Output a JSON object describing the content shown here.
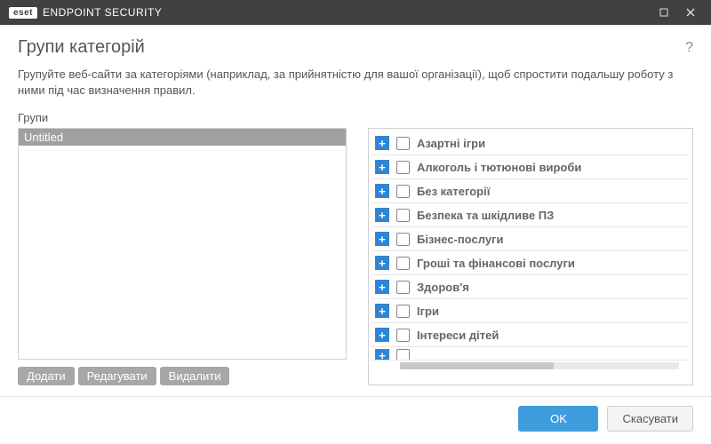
{
  "window": {
    "brand": "eset",
    "product": "ENDPOINT SECURITY"
  },
  "page": {
    "title": "Групи категорій",
    "help_glyph": "?",
    "description": "Групуйте веб-сайти за категоріями (наприклад, за прийнятністю для вашої організації), щоб спростити подальшу роботу з ними під час визначення правил.",
    "groups_label": "Групи"
  },
  "groups": {
    "items": [
      {
        "name": "Untitled",
        "selected": true
      }
    ],
    "actions": {
      "add": "Додати",
      "edit": "Редагувати",
      "delete": "Видалити"
    }
  },
  "categories": [
    {
      "label": "Азартні ігри",
      "checked": false
    },
    {
      "label": "Алкоголь і тютюнові вироби",
      "checked": false
    },
    {
      "label": "Без категорії",
      "checked": false
    },
    {
      "label": "Безпека та шкідливе ПЗ",
      "checked": false
    },
    {
      "label": "Бізнес-послуги",
      "checked": false
    },
    {
      "label": "Гроші та фінансові послуги",
      "checked": false
    },
    {
      "label": "Здоров'я",
      "checked": false
    },
    {
      "label": "Ігри",
      "checked": false
    },
    {
      "label": "Інтереси дітей",
      "checked": false
    }
  ],
  "footer": {
    "ok": "OK",
    "cancel": "Скасувати"
  }
}
